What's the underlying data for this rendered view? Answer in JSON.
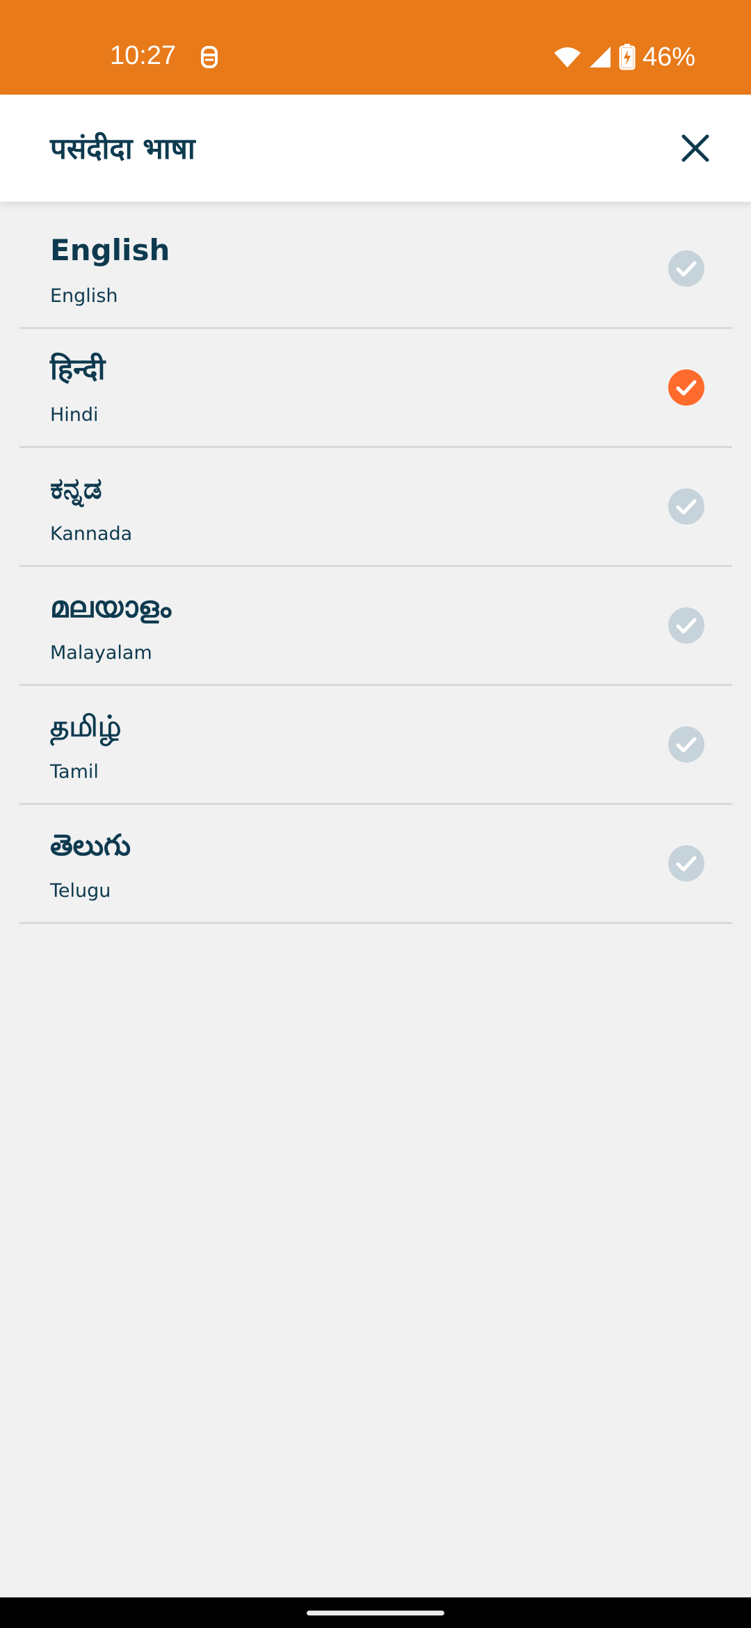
{
  "status_bar": {
    "time": "10:27",
    "battery_text": "46%",
    "icons": [
      "notification-icon",
      "wifi-icon",
      "signal-icon",
      "battery-charging-icon"
    ]
  },
  "header": {
    "title": "पसंदीदा भाषा",
    "close_icon": "close-icon"
  },
  "languages": [
    {
      "native": "English",
      "english": "English",
      "selected": false
    },
    {
      "native": "हिन्दी",
      "english": "Hindi",
      "selected": true
    },
    {
      "native": "ಕನ್ನಡ",
      "english": "Kannada",
      "selected": false
    },
    {
      "native": "മലയാളം",
      "english": "Malayalam",
      "selected": false
    },
    {
      "native": "தமிழ்",
      "english": "Tamil",
      "selected": false
    },
    {
      "native": "తెలుగు",
      "english": "Telugu",
      "selected": false
    }
  ],
  "colors": {
    "status_bar": "#e87a1a",
    "text_primary": "#0e3a4f",
    "check_selected": "#ff6b2c",
    "check_unselected": "#c6d3da",
    "background": "#f1f1f1"
  }
}
